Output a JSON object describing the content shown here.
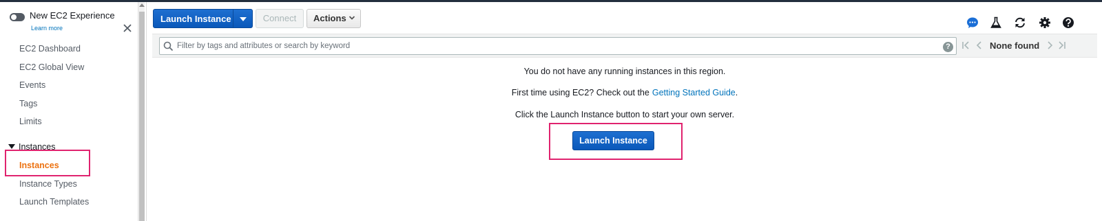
{
  "sidebar": {
    "toggle_label": "New EC2 Experience",
    "learn_more": "Learn more",
    "items": [
      {
        "label": "EC2 Dashboard"
      },
      {
        "label": "EC2 Global View"
      },
      {
        "label": "Events"
      },
      {
        "label": "Tags"
      },
      {
        "label": "Limits"
      }
    ],
    "section": {
      "label": "Instances",
      "items": [
        {
          "label": "Instances",
          "active": true
        },
        {
          "label": "Instance Types"
        },
        {
          "label": "Launch Templates"
        }
      ]
    }
  },
  "toolbar": {
    "launch_label": "Launch Instance",
    "connect_label": "Connect",
    "actions_label": "Actions",
    "icons": [
      "chat-icon",
      "flask-icon",
      "refresh-icon",
      "settings-gear-icon",
      "help-icon"
    ]
  },
  "filter": {
    "placeholder": "Filter by tags and attributes or search by keyword",
    "help": "?",
    "status": "None found"
  },
  "empty_state": {
    "line1": "You do not have any running instances in this region.",
    "line2_prefix": "First time using EC2? Check out the",
    "line2_link": "Getting Started Guide",
    "line2_suffix": ".",
    "line3": "Click the Launch Instance button to start your own server.",
    "button_label": "Launch Instance"
  },
  "colors": {
    "primary": "#0a58ba",
    "active_nav": "#ec7211",
    "highlight": "#e0226e",
    "link": "#0073bb"
  }
}
